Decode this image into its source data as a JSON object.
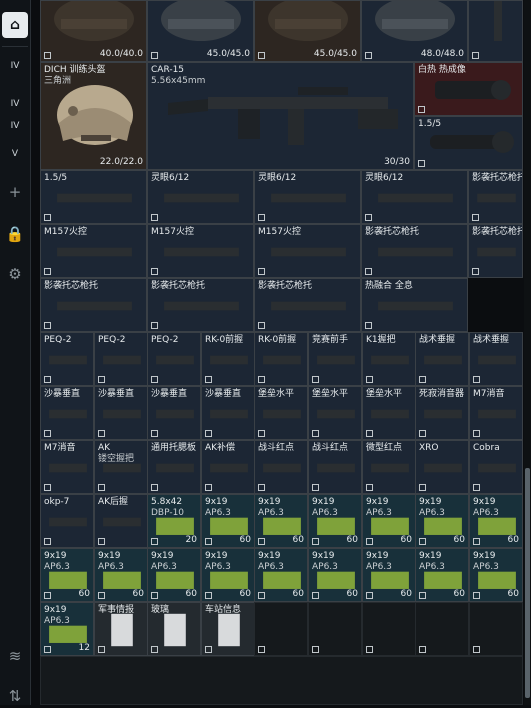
{
  "sidebar": {
    "tabs": [
      {
        "label": "IV",
        "icon": "tv-icon"
      },
      {
        "label": "IV",
        "icon": "tv-icon"
      },
      {
        "label": "IV",
        "icon": "tv-icon"
      },
      {
        "label": "V",
        "icon": "tv-icon"
      }
    ]
  },
  "row_top": [
    {
      "name": "",
      "count": "40.0/40.0"
    },
    {
      "name": "",
      "count": "45.0/45.0"
    },
    {
      "name": "",
      "count": "45.0/45.0"
    },
    {
      "name": "",
      "count": "48.0/48.0"
    },
    {
      "name": "",
      "count": ""
    }
  ],
  "big_items": {
    "helmet": {
      "name": "DICH 训练头盔",
      "sub": "三角洲",
      "count": "22.0/22.0"
    },
    "rifle": {
      "name": "CAR-15",
      "sub": "5.56x45mm",
      "count": "30/30"
    },
    "thermal": {
      "name": "白热 热成像"
    },
    "scope_small": {
      "name": "1.5/5"
    }
  },
  "grid_items": [
    {
      "name": "1.5/5",
      "sub": "",
      "count": ""
    },
    {
      "name": "灵眼6/12",
      "sub": "",
      "count": ""
    },
    {
      "name": "灵眼6/12",
      "sub": "",
      "count": ""
    },
    {
      "name": "灵眼6/12",
      "sub": "",
      "count": ""
    },
    {
      "name": "影袭托芯枪托",
      "sub": "",
      "count": ""
    },
    {
      "name": "M157火控",
      "sub": "",
      "count": ""
    },
    {
      "name": "M157火控",
      "sub": "",
      "count": ""
    },
    {
      "name": "M157火控",
      "sub": "",
      "count": ""
    },
    {
      "name": "影袭托芯枪托",
      "sub": "",
      "count": ""
    },
    {
      "name": "影袭托芯枪托",
      "sub": "",
      "count": ""
    },
    {
      "name": "影袭托芯枪托",
      "sub": "",
      "count": ""
    },
    {
      "name": "影袭托芯枪托",
      "sub": "",
      "count": ""
    },
    {
      "name": "影袭托芯枪托",
      "sub": "",
      "count": ""
    },
    {
      "name": "热融合 全息",
      "sub": "",
      "count": ""
    }
  ],
  "small_items": [
    {
      "name": "PEQ-2",
      "sub": "",
      "count": ""
    },
    {
      "name": "PEQ-2",
      "sub": "",
      "count": ""
    },
    {
      "name": "PEQ-2",
      "sub": "",
      "count": ""
    },
    {
      "name": "RK-0前握",
      "sub": "",
      "count": ""
    },
    {
      "name": "RK-0前握",
      "sub": "",
      "count": ""
    },
    {
      "name": "竞赛前手",
      "sub": "",
      "count": ""
    },
    {
      "name": "K1握把",
      "sub": "",
      "count": ""
    },
    {
      "name": "战术垂握",
      "sub": "",
      "count": ""
    },
    {
      "name": "战术垂握",
      "sub": "",
      "count": ""
    },
    {
      "name": "沙暴垂直",
      "sub": "",
      "count": ""
    },
    {
      "name": "沙暴垂直",
      "sub": "",
      "count": ""
    },
    {
      "name": "沙暴垂直",
      "sub": "",
      "count": ""
    },
    {
      "name": "沙暴垂直",
      "sub": "",
      "count": ""
    },
    {
      "name": "堡垒水平",
      "sub": "",
      "count": ""
    },
    {
      "name": "堡垒水平",
      "sub": "",
      "count": ""
    },
    {
      "name": "堡垒水平",
      "sub": "",
      "count": ""
    },
    {
      "name": "死寂消音器",
      "sub": "",
      "count": ""
    },
    {
      "name": "M7消音",
      "sub": "",
      "count": ""
    },
    {
      "name": "M7消音",
      "sub": "",
      "count": ""
    },
    {
      "name": "AK",
      "sub": "镂空握把",
      "count": ""
    },
    {
      "name": "通用托腮板",
      "sub": "",
      "count": ""
    },
    {
      "name": "AK补偿",
      "sub": "",
      "count": ""
    },
    {
      "name": "战斗红点",
      "sub": "",
      "count": ""
    },
    {
      "name": "战斗红点",
      "sub": "",
      "count": ""
    },
    {
      "name": "微型红点",
      "sub": "",
      "count": ""
    },
    {
      "name": "XRO",
      "sub": "",
      "count": ""
    },
    {
      "name": "Cobra",
      "sub": "",
      "count": ""
    },
    {
      "name": "okp-7",
      "sub": "",
      "count": ""
    },
    {
      "name": "AK后握",
      "sub": "",
      "count": ""
    },
    {
      "name": "5.8x42",
      "sub": "DBP-10",
      "count": "20"
    },
    {
      "name": "9x19",
      "sub": "AP6.3",
      "count": "60"
    },
    {
      "name": "9x19",
      "sub": "AP6.3",
      "count": "60"
    },
    {
      "name": "9x19",
      "sub": "AP6.3",
      "count": "60"
    },
    {
      "name": "9x19",
      "sub": "AP6.3",
      "count": "60"
    },
    {
      "name": "9x19",
      "sub": "AP6.3",
      "count": "60"
    },
    {
      "name": "9x19",
      "sub": "AP6.3",
      "count": "60"
    },
    {
      "name": "9x19",
      "sub": "AP6.3",
      "count": "60"
    },
    {
      "name": "9x19",
      "sub": "AP6.3",
      "count": "60"
    },
    {
      "name": "9x19",
      "sub": "AP6.3",
      "count": "60"
    },
    {
      "name": "9x19",
      "sub": "AP6.3",
      "count": "60"
    },
    {
      "name": "9x19",
      "sub": "AP6.3",
      "count": "60"
    },
    {
      "name": "9x19",
      "sub": "AP6.3",
      "count": "60"
    },
    {
      "name": "9x19",
      "sub": "AP6.3",
      "count": "60"
    },
    {
      "name": "9x19",
      "sub": "AP6.3",
      "count": "60"
    },
    {
      "name": "9x19",
      "sub": "AP6.3",
      "count": "60"
    },
    {
      "name": "9x19",
      "sub": "AP6.3",
      "count": "12"
    },
    {
      "name": "军事情报",
      "sub": "",
      "count": ""
    },
    {
      "name": "玻璃",
      "sub": "",
      "count": ""
    },
    {
      "name": "车站信息",
      "sub": "",
      "count": ""
    }
  ]
}
